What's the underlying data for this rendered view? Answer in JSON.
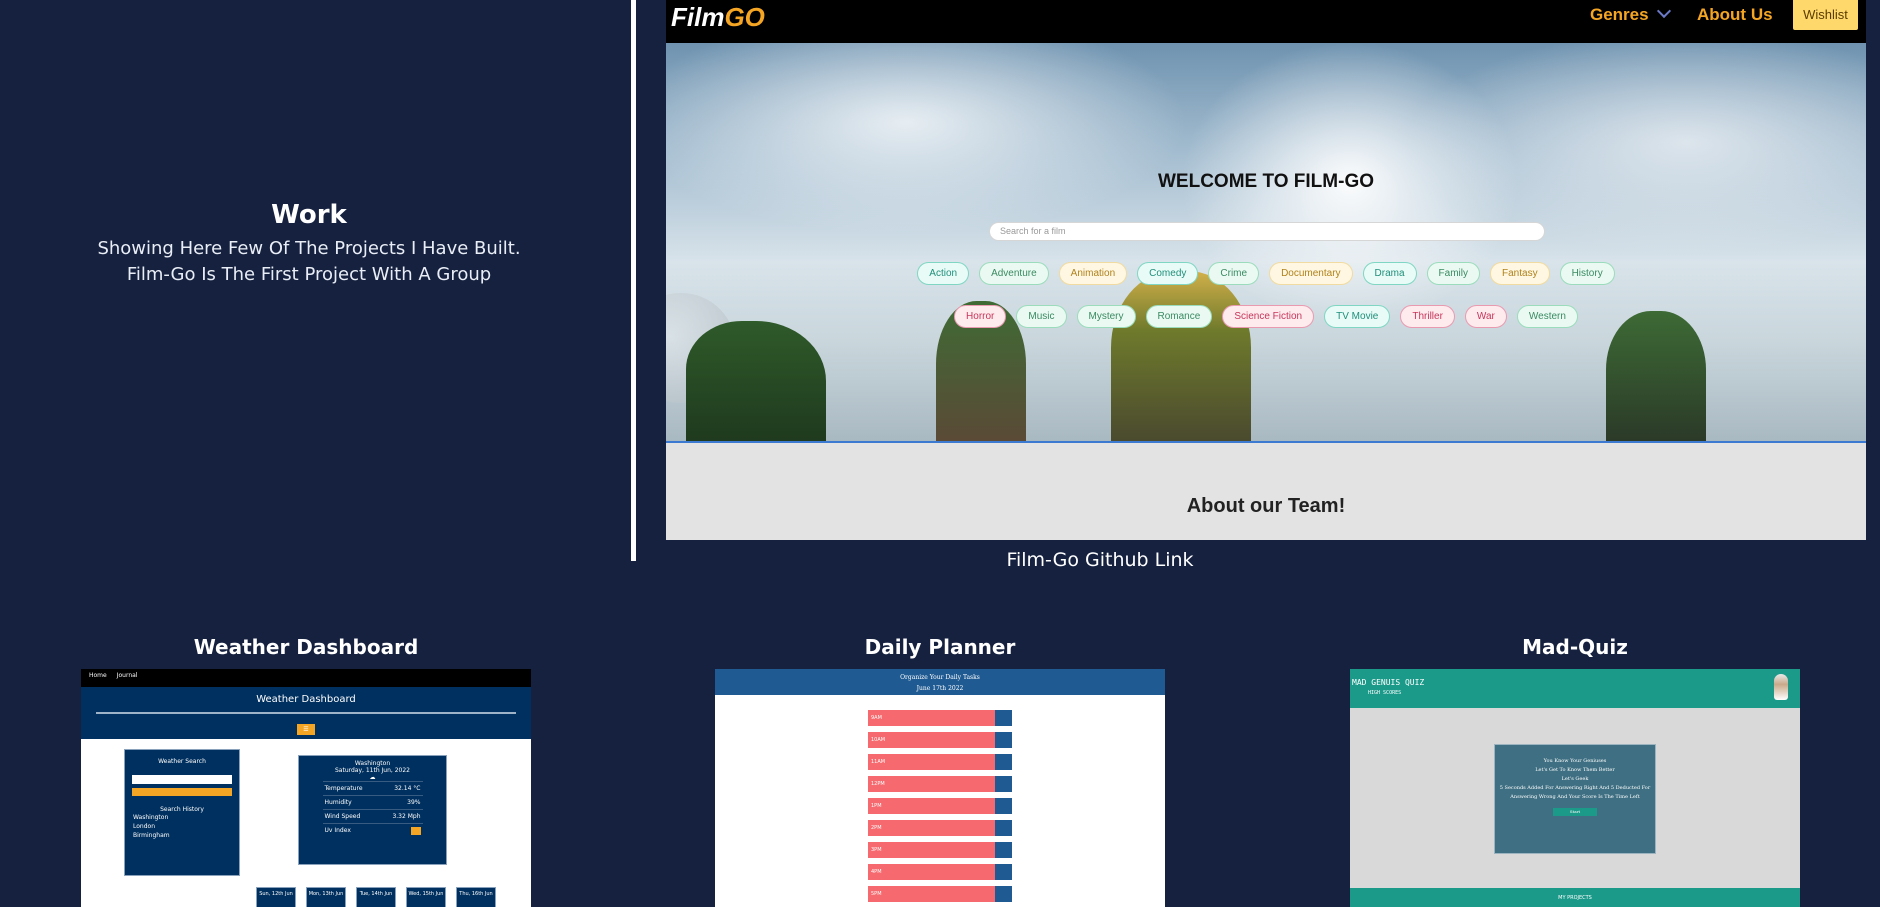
{
  "work": {
    "title": "Work",
    "desc_line1": "Showing Here Few Of The Projects I Have Built.",
    "desc_line2": "Film-Go Is The First Project With A Group"
  },
  "featured": {
    "logo_film": "Film",
    "logo_go": "GO",
    "nav": {
      "genres": "Genres",
      "about": "About Us",
      "wishlist": "Wishlist"
    },
    "welcome": "WELCOME TO FILM-GO",
    "search_placeholder": "Search for a film",
    "genres_row1": [
      {
        "label": "Action",
        "style": "teal"
      },
      {
        "label": "Adventure",
        "style": "mint"
      },
      {
        "label": "Animation",
        "style": "cream"
      },
      {
        "label": "Comedy",
        "style": "teal"
      },
      {
        "label": "Crime",
        "style": "mint"
      },
      {
        "label": "Documentary",
        "style": "cream"
      },
      {
        "label": "Drama",
        "style": "teal"
      },
      {
        "label": "Family",
        "style": "mint"
      },
      {
        "label": "Fantasy",
        "style": "cream"
      },
      {
        "label": "History",
        "style": "mint"
      }
    ],
    "genres_row2": [
      {
        "label": "Horror",
        "style": "pink"
      },
      {
        "label": "Music",
        "style": "mint"
      },
      {
        "label": "Mystery",
        "style": "mint"
      },
      {
        "label": "Romance",
        "style": "mint"
      },
      {
        "label": "Science Fiction",
        "style": "pink"
      },
      {
        "label": "TV Movie",
        "style": "teal"
      },
      {
        "label": "Thriller",
        "style": "pink"
      },
      {
        "label": "War",
        "style": "pink"
      },
      {
        "label": "Western",
        "style": "mint"
      }
    ],
    "team_heading": "About our Team!",
    "github_link": "Film-Go Github Link"
  },
  "projects": {
    "weather": {
      "title": "Weather Dashboard",
      "nav": [
        "Home",
        "Journal"
      ],
      "header": "Weather Dashboard",
      "search_title": "Weather Search",
      "search_history_title": "Search History",
      "history": [
        "Washington",
        "London",
        "Birmingham"
      ],
      "city": "Washington",
      "date": "Saturday, 11th Jun, 2022",
      "rows": [
        {
          "label": "Temperature",
          "value": "32.14 °C"
        },
        {
          "label": "Humidity",
          "value": "39%"
        },
        {
          "label": "Wind Speed",
          "value": "3.32 Mph"
        },
        {
          "label": "Uv Index",
          "value": ""
        }
      ],
      "days": [
        "Sun, 12th Jun",
        "Mon, 13th Jun",
        "Tue, 14th Jun",
        "Wed, 15th Jun",
        "Thu, 16th Jun"
      ]
    },
    "planner": {
      "title": "Daily Planner",
      "header_line1": "Organize Your Daily Tasks",
      "header_line2": "June 17th 2022",
      "slots": [
        "9AM",
        "10AM",
        "11AM",
        "12PM",
        "1PM",
        "2PM",
        "3PM",
        "4PM",
        "5PM"
      ]
    },
    "quiz": {
      "title": "Mad-Quiz",
      "brand": "MAD GENUIS QUIZ",
      "sub": "HIGH SCORES",
      "box_line1": "You Know Your Geniuses",
      "box_line2": "Let's Get To Know Them Better",
      "box_line3": "Let's Geek",
      "box_line4": "5 Seconds Added For Answering Right And 5 Deducted For Answering Wrong And Your Score Is The Time Left",
      "start": "Start",
      "footer": "MY PROJECTS"
    }
  }
}
